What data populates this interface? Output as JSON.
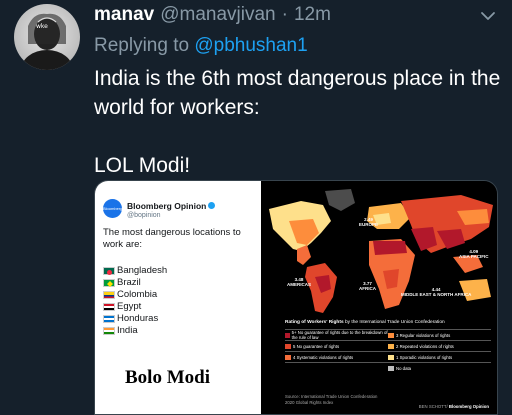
{
  "tweet": {
    "display_name": "manav",
    "handle": "@manavjivan",
    "separator": "·",
    "time": "12m",
    "reply_prefix": "Replying to",
    "reply_to": "@pbhushan1",
    "text_line1": "India is the 6th most dangerous place in the world for workers:",
    "text_line2": "LOL Modi!"
  },
  "avatar": {
    "icon": "avatar-icon",
    "caption": "wke"
  },
  "icons": {
    "menu": "chevron-down-icon"
  },
  "embedded_image": {
    "bloomberg_tweet": {
      "account_name": "Bloomberg Opinion",
      "account_handle": "@bopinion",
      "logo_text": "Bloomberg",
      "text": "The most dangerous locations to work are:",
      "countries": [
        {
          "name": "Bangladesh",
          "flag": "bangladesh-flag-icon"
        },
        {
          "name": "Brazil",
          "flag": "brazil-flag-icon"
        },
        {
          "name": "Colombia",
          "flag": "colombia-flag-icon"
        },
        {
          "name": "Egypt",
          "flag": "egypt-flag-icon"
        },
        {
          "name": "Honduras",
          "flag": "honduras-flag-icon"
        },
        {
          "name": "India",
          "flag": "india-flag-icon"
        }
      ]
    },
    "overlay_text": "Bolo Modi",
    "map": {
      "regions": [
        {
          "id": "europe",
          "value": "2.49",
          "label": "EUROPE"
        },
        {
          "id": "asia_pacific",
          "value": "4.09",
          "label": "ASIA PACIFIC"
        },
        {
          "id": "americas",
          "value": "3.48",
          "label": "AMERICAS"
        },
        {
          "id": "africa",
          "value": "3.77",
          "label": "AFRICA"
        },
        {
          "id": "mena",
          "value": "4.44",
          "label": "MIDDLE EAST & NORTH AFRICA"
        }
      ],
      "rating_title_bold": "Rating of Workers' Rights",
      "rating_title_rest": "by the International Trade Union Confederation",
      "legend": [
        {
          "label": "5+ No guarantee of rights due to the breakdown of the rule of law",
          "color": "#b2182b"
        },
        {
          "label": "3 Regular violations of rights",
          "color": "#fd8d3c"
        },
        {
          "label": "5 No guarantee of rights",
          "color": "#e0462b"
        },
        {
          "label": "2 Repeated violations of rights",
          "color": "#fdb24a"
        },
        {
          "label": "4 Systematic violations of rights",
          "color": "#f46d3a"
        },
        {
          "label": "1 Sporadic violations of rights",
          "color": "#fee08b"
        },
        {
          "label": "No data",
          "color": "#bdbdbd"
        }
      ],
      "source_line1": "Source: International Trade Union Confederation",
      "source_line2": "2020 Global Rights Index",
      "credit_author": "BEN SCHOTT/",
      "credit_brand": "Bloomberg Opinion"
    }
  },
  "colors": {
    "background": "#15202b",
    "link": "#1da1f2",
    "muted": "#8899a6"
  }
}
